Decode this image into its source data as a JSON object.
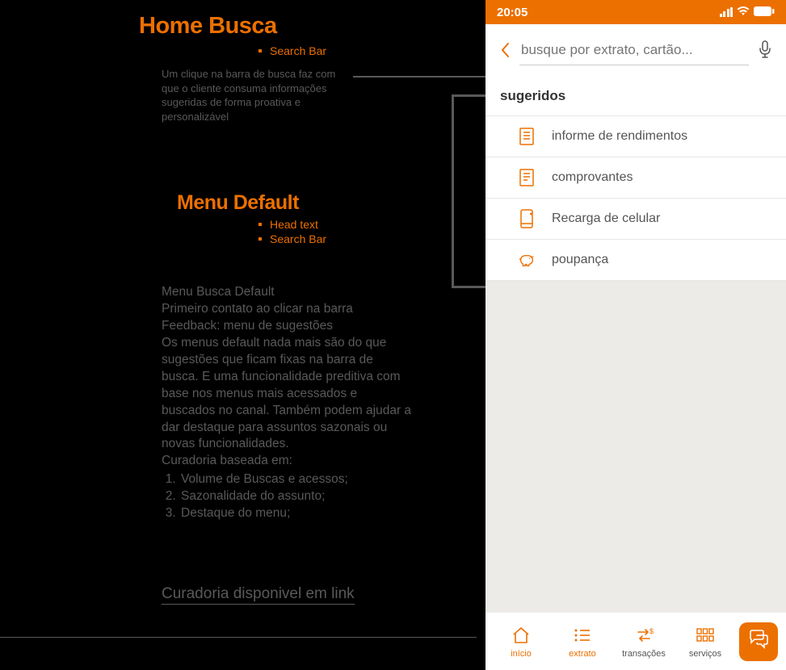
{
  "left": {
    "title1": "Home Busca",
    "bullets1": [
      "Search Bar"
    ],
    "note1": "Um clique na barra de busca faz com que o cliente consuma informações sugeridas de forma proativa e personalizável",
    "title2": "Menu Default",
    "bullets2": [
      "Head text",
      "Search Bar"
    ],
    "body": {
      "line1": "Menu Busca Default",
      "line2": "Primeiro contato ao clicar na barra",
      "line3": "Feedback: menu de sugestões",
      "para": "Os menus default nada mais são do que sugestões que ficam fixas na barra de busca. E uma funcionalidade preditiva com base nos menus mais acessados e buscados no canal. Também podem ajudar a dar destaque para assuntos sazonais ou novas funcionalidades.",
      "curadoria_label": "Curadoria baseada em:",
      "items": [
        "Volume de Buscas e acessos;",
        "Sazonalidade do assunto;",
        "Destaque do menu;"
      ]
    },
    "link": "Curadoria disponivel em link"
  },
  "phone": {
    "status_time": "20:05",
    "search_placeholder": "busque por extrato, cartão...",
    "suggested_header": "sugeridos",
    "suggestions": [
      {
        "icon": "document",
        "label": "informe de rendimentos"
      },
      {
        "icon": "receipt",
        "label": "comprovantes"
      },
      {
        "icon": "phone",
        "label": "Recarga de celular"
      },
      {
        "icon": "piggy",
        "label": "poupança"
      }
    ],
    "nav": {
      "inicio": "início",
      "extrato": "extrato",
      "transacoes": "transações",
      "servicos": "serviços"
    }
  }
}
